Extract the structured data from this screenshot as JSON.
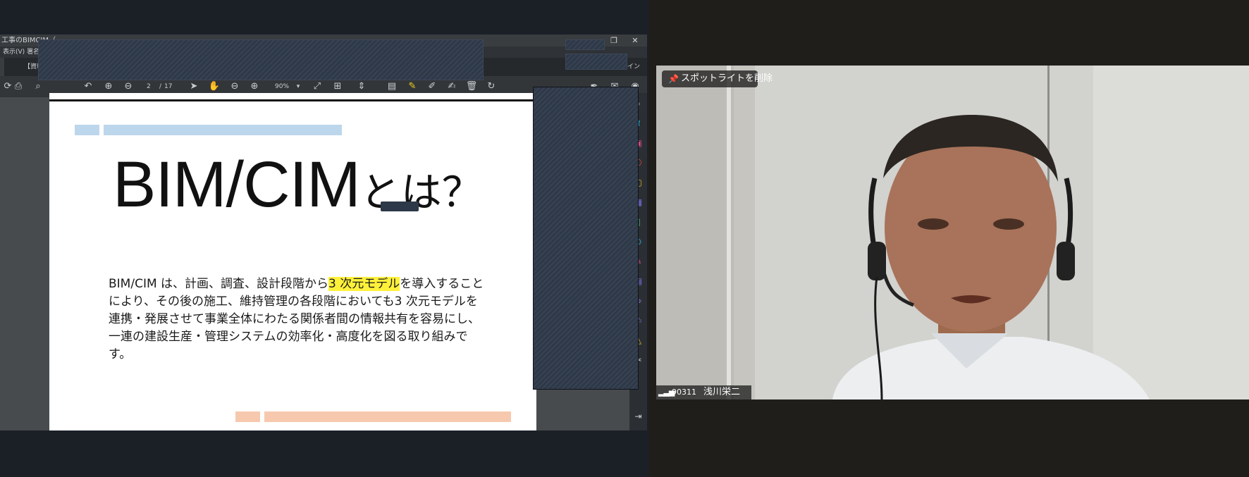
{
  "pdf_viewer": {
    "title": "工事のBIMCIM（",
    "window_buttons": {
      "restore": "❐",
      "close": "✕"
    },
    "menu": {
      "view": "表示(V)",
      "sign": "署名"
    },
    "tab": {
      "label": "【資料"
    },
    "tab_right_text": "イン",
    "page": {
      "current": "2",
      "separator": "/",
      "total": "17"
    },
    "zoom": "90%"
  },
  "slide": {
    "title_main": "BIM/CIM",
    "title_suffix": "とは？",
    "body_pre": "BIM/CIM は、計画、調査、設計段階から",
    "body_highlight": "3 次元モデル",
    "body_post": "を導入することにより、その後の施工、維持管理の各段階においても3 次元モデルを連携・発展させて事業全体にわたる関係者間の情報共有を容易にし、一連の建設生産・管理システムの効率化・高度化を図る取り組みです。",
    "accent_colors": {
      "top_bars": "#bcd6ec",
      "bottom_bars": "#f6c9ae",
      "highlight": "#fff13a"
    }
  },
  "video": {
    "spotlight_label": "スポットライトを削除",
    "participant_id": "90311",
    "participant_name": "浅川栄二"
  }
}
